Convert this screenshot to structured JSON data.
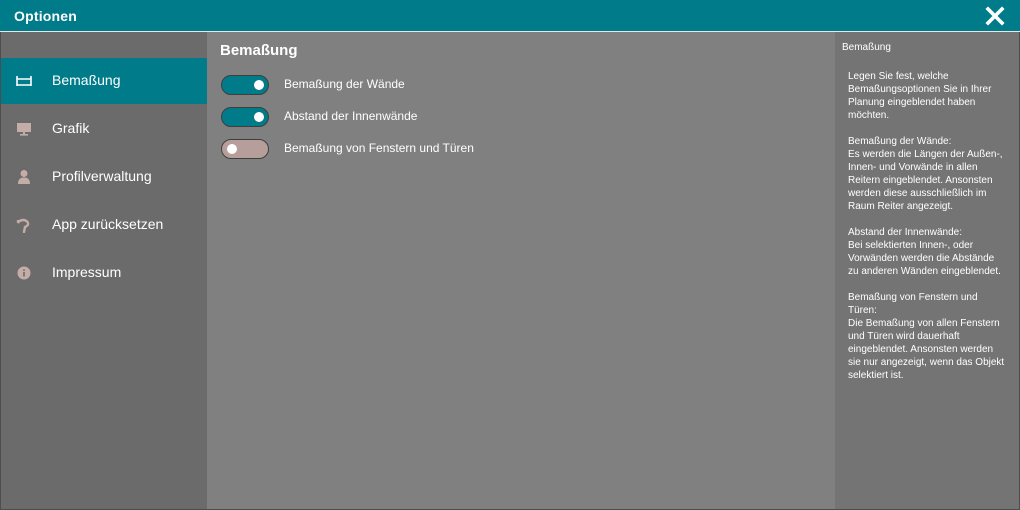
{
  "window": {
    "title": "Optionen",
    "close_icon": "close-icon"
  },
  "sidebar": {
    "items": [
      {
        "label": "Bemaßung",
        "icon": "dimension-icon",
        "active": true
      },
      {
        "label": "Grafik",
        "icon": "monitor-icon",
        "active": false
      },
      {
        "label": "Profilverwaltung",
        "icon": "user-icon",
        "active": false
      },
      {
        "label": "App zurücksetzen",
        "icon": "reset-icon",
        "active": false
      },
      {
        "label": "Impressum",
        "icon": "info-icon",
        "active": false
      }
    ]
  },
  "main": {
    "heading": "Bemaßung",
    "options": [
      {
        "label": "Bemaßung der Wände",
        "enabled": true
      },
      {
        "label": "Abstand der Innenwände",
        "enabled": true
      },
      {
        "label": "Bemaßung von Fenstern und Türen",
        "enabled": false
      }
    ]
  },
  "help": {
    "title": "Bemaßung",
    "text": "Legen Sie fest, welche Bemaßungsoptionen Sie in Ihrer Planung eingeblendet haben möchten.\n\nBemaßung der Wände:\nEs werden die Längen der Außen-, Innen- und Vorwände in allen Reitern eingeblendet. Ansonsten werden diese ausschließlich im Raum Reiter angezeigt.\n\nAbstand der Innenwände:\nBei selektierten Innen-, oder Vorwänden werden die Abstände zu anderen Wänden eingeblendet.\n\nBemaßung von Fenstern und Türen:\nDie Bemaßung von allen Fenstern und Türen wird dauerhaft eingeblendet. Ansonsten werden sie nur angezeigt, wenn das Objekt selektiert ist."
  },
  "colors": {
    "accent": "#007b8a",
    "toggle_off": "#b69e9a",
    "icon": "#c4aca7"
  }
}
